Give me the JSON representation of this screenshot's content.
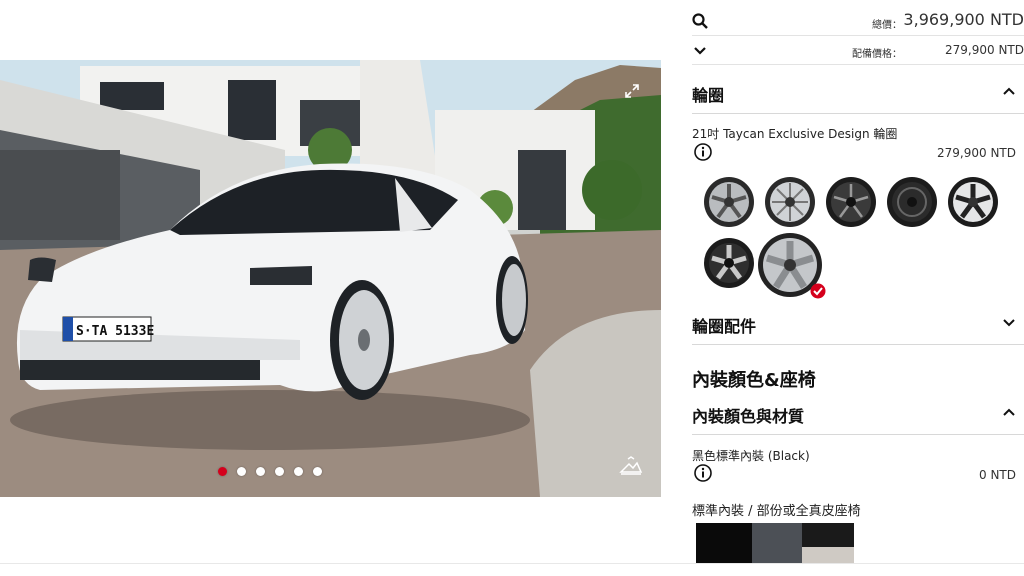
{
  "viewer": {
    "plate_text": "S·TA 5133E",
    "carousel_total": 6,
    "carousel_active_index": 0
  },
  "summary": {
    "total_label": "總價：",
    "total_value": "3,969,900 NTD",
    "equipment_label": "配備價格：",
    "equipment_value": "279,900 NTD"
  },
  "wheels": {
    "section_title": "輪圈",
    "selected_name": "21吋 Taycan Exclusive Design 輪圈",
    "selected_price": "279,900 NTD",
    "count": 7,
    "selected_index": 6
  },
  "wheel_accessories": {
    "section_title": "輪圈配件"
  },
  "interior": {
    "group_title": "內裝顏色&座椅",
    "section_title": "內裝顏色與材質",
    "selected_name": "黑色標準內裝 (Black)",
    "selected_price": "0 NTD",
    "seats_label": "標準內裝 / 部份或全真皮座椅",
    "swatches": [
      "#0a0a0a",
      "#4c5056",
      "#1a1a1a"
    ]
  },
  "colors": {
    "accent": "#d5001c",
    "divider": "#d8d8d8"
  },
  "icons": {
    "search": "search-icon",
    "chevron_down": "chevron-down-icon",
    "chevron_up": "chevron-up-icon",
    "info": "info-icon",
    "expand": "expand-icon",
    "scene": "scene-toggle-icon",
    "check": "check-badge-icon"
  }
}
